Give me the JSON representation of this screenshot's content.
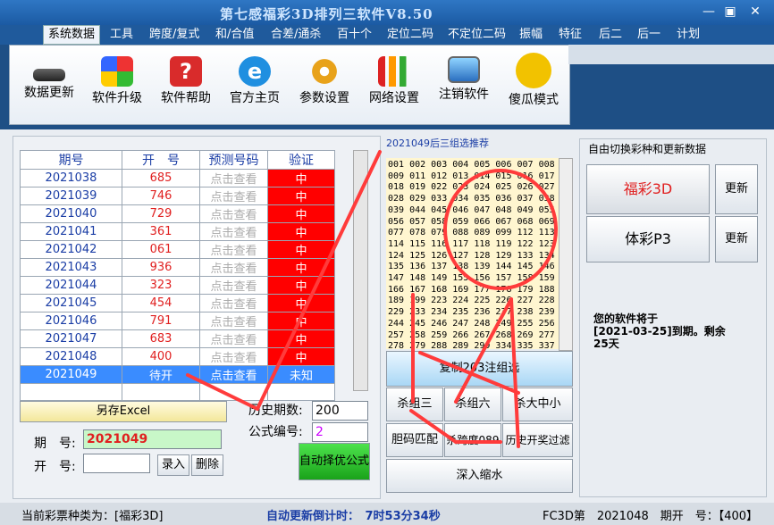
{
  "window": {
    "title": "第七感福彩3D排列三软件V8.50",
    "min": "—",
    "restore": "▣",
    "close": "✕"
  },
  "menu": [
    "系统数据",
    "工具",
    "跨度/复式",
    "和/合值",
    "合差/通杀",
    "百十个",
    "定位二码",
    "不定位二码",
    "振幅",
    "特征",
    "后二",
    "后一",
    "计划"
  ],
  "ribbon": [
    {
      "label": "数据更新",
      "icon": "chip-icon",
      "color": "#444444"
    },
    {
      "label": "软件升级",
      "icon": "windows-icon",
      "color": "#3a7de0"
    },
    {
      "label": "软件帮助",
      "icon": "help-icon",
      "color": "#d92b2b"
    },
    {
      "label": "官方主页",
      "icon": "ie-icon",
      "color": "#1f8fe0"
    },
    {
      "label": "参数设置",
      "icon": "gears-icon",
      "color": "#e8a21a"
    },
    {
      "label": "网络设置",
      "icon": "bars-icon",
      "color": "#3a9a3a"
    },
    {
      "label": "注销软件",
      "icon": "monitor-icon",
      "color": "#2a6fc0"
    },
    {
      "label": "傻瓜模式",
      "icon": "smiley-icon",
      "color": "#f2c200"
    }
  ],
  "table": {
    "headers": [
      "期号",
      "开　号",
      "预测号码",
      "验证"
    ],
    "rows": [
      [
        "2021038",
        "685",
        "点击查看",
        "中"
      ],
      [
        "2021039",
        "746",
        "点击查看",
        "中"
      ],
      [
        "2021040",
        "729",
        "点击查看",
        "中"
      ],
      [
        "2021041",
        "361",
        "点击查看",
        "中"
      ],
      [
        "2021042",
        "061",
        "点击查看",
        "中"
      ],
      [
        "2021043",
        "936",
        "点击查看",
        "中"
      ],
      [
        "2021044",
        "323",
        "点击查看",
        "中"
      ],
      [
        "2021045",
        "454",
        "点击查看",
        "中"
      ],
      [
        "2021046",
        "791",
        "点击查看",
        "中"
      ],
      [
        "2021047",
        "683",
        "点击查看",
        "中"
      ],
      [
        "2021048",
        "400",
        "点击查看",
        "中"
      ]
    ],
    "pending": [
      "2021049",
      "待开",
      "点击查看",
      "未知"
    ]
  },
  "left_controls": {
    "save_excel": "另存Excel",
    "history_label": "历史期数:",
    "history_value": "200",
    "formula_label": "公式编号:",
    "formula_value": "2",
    "auto_btn": "自动择优公式",
    "period_label": "期　号:",
    "period_value": "2021049",
    "open_label": "开　号:",
    "open_value": "",
    "enter_btn": "录入",
    "delete_btn": "删除"
  },
  "middle": {
    "title": "2021049后三组选推荐",
    "numbers": "001 002 003 004 005 006 007 008\n009 011 012 013 014 015 016 017\n018 019 022 023 024 025 026 027\n028 029 033 034 035 036 037 038\n039 044 045 046 047 048 049 055\n056 057 058 059 066 067 068 069\n077 078 079 088 089 099 112 113\n114 115 116 117 118 119 122 123\n124 125 126 127 128 129 133 134\n135 136 137 138 139 144 145 146\n147 148 149 155 156 157 158 159\n166 167 168 169 177 178 179 188\n189 199 223 224 225 226 227 228\n229 233 234 235 236 237 238 239\n244 245 246 247 248 249 255 256\n257 258 259 266 267 268 269 277\n278 279 288 289 299 334 335 337",
    "copy_btn": "复制203注组选",
    "btn_kill3": "杀组三",
    "btn_kill6": "杀组六",
    "btn_kill_size": "杀大中小",
    "btn_dan": "胆码匹配",
    "btn_span": "杀跨度089",
    "btn_hist": "历史开奖过滤",
    "btn_deep": "深入缩水"
  },
  "right": {
    "title": "自由切换彩种和更新数据",
    "fc3d": "福彩3D",
    "pl3": "体彩P3",
    "update": "更新",
    "expire": "您的软件将于\n[2021-03-25]到期。剩余\n25天"
  },
  "status": {
    "type": "当前彩票种类为：[福彩3D]",
    "countdown": "自动更新倒计时：　7时53分34秒",
    "last": "FC3D第　2021048　期开　号：【400】"
  }
}
